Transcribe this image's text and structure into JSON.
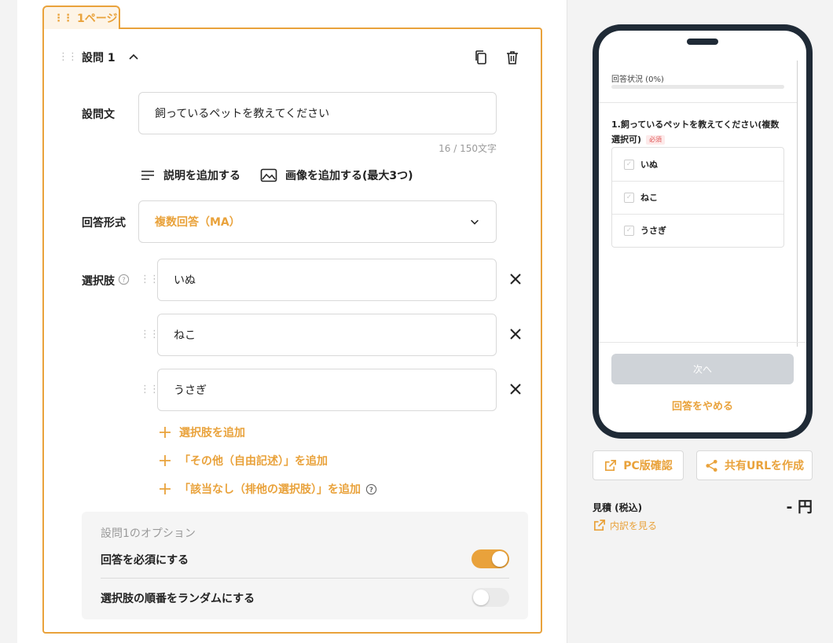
{
  "page_tab": {
    "label": "1ページ"
  },
  "question": {
    "title": "設問 1",
    "text_label": "設問文",
    "text_value": "飼っているペットを教えてください",
    "char_count": "16 / 150文字",
    "add_description": "説明を追加する",
    "add_image": "画像を追加する(最大3つ)",
    "answer_type_label": "回答形式",
    "answer_type_value": "複数回答（MA）",
    "choices_label": "選択肢",
    "choices": [
      {
        "value": "いぬ"
      },
      {
        "value": "ねこ"
      },
      {
        "value": "うさぎ"
      }
    ],
    "add_choice": "選択肢を追加",
    "add_other": "「その他（自由記述）」を追加",
    "add_none": "「該当なし（排他の選択肢）」を追加"
  },
  "options": {
    "heading": "設問1のオプション",
    "required_label": "回答を必須にする",
    "required_on": true,
    "random_label": "選択肢の順番をランダムにする",
    "random_on": false
  },
  "preview": {
    "progress_label": "回答状況 (0%)",
    "progress": 0,
    "question_line1": "1.飼っているペットを教えてください(複数",
    "question_line2": "選択可)",
    "required_badge": "必須",
    "choices": [
      "いぬ",
      "ねこ",
      "うさぎ"
    ],
    "next_button": "次へ",
    "quit_link": "回答をやめる"
  },
  "actions": {
    "pc_check": "PC版確認",
    "share_url": "共有URLを作成"
  },
  "estimate": {
    "label": "見積 (税込)",
    "value": "- 円",
    "breakdown_link": "内訳を見る"
  },
  "colors": {
    "accent": "#e9a23b",
    "phone_frame": "#1f2a36"
  }
}
